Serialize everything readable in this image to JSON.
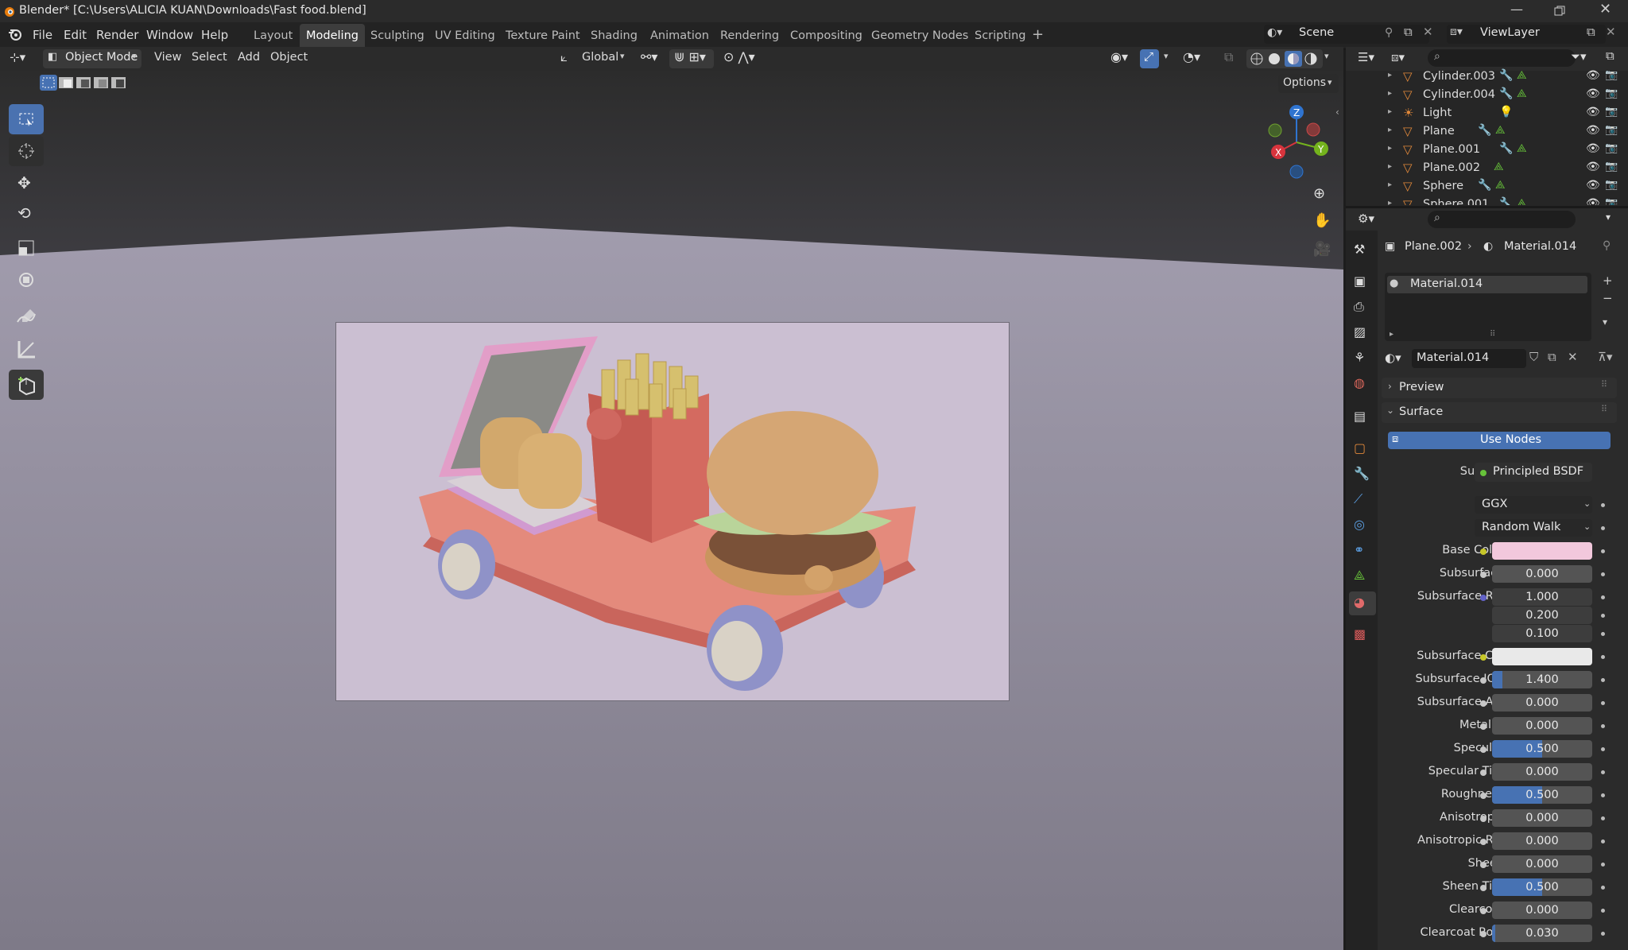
{
  "window": {
    "title": "Blender* [C:\\Users\\ALICIA KUAN\\Downloads\\Fast food.blend]"
  },
  "menus": [
    "File",
    "Edit",
    "Render",
    "Window",
    "Help"
  ],
  "workspaces": [
    "Layout",
    "Modeling",
    "Sculpting",
    "UV Editing",
    "Texture Paint",
    "Shading",
    "Animation",
    "Rendering",
    "Compositing",
    "Geometry Nodes",
    "Scripting"
  ],
  "active_workspace": "Modeling",
  "scene": {
    "label": "Scene"
  },
  "viewlayer": {
    "label": "ViewLayer"
  },
  "viewport_header": {
    "mode": "Object Mode",
    "view": "View",
    "select": "Select",
    "add": "Add",
    "object": "Object",
    "orientation": "Global",
    "options": "Options"
  },
  "gizmo": {
    "z": "Z",
    "y": "Y",
    "x": "X"
  },
  "outliner": {
    "items": [
      {
        "name": "Cylinder.003",
        "type": "mesh"
      },
      {
        "name": "Cylinder.004",
        "type": "mesh"
      },
      {
        "name": "Light",
        "type": "light"
      },
      {
        "name": "Plane",
        "type": "mesh"
      },
      {
        "name": "Plane.001",
        "type": "mesh"
      },
      {
        "name": "Plane.002",
        "type": "mesh"
      },
      {
        "name": "Sphere",
        "type": "mesh"
      },
      {
        "name": "Sphere.001",
        "type": "mesh"
      }
    ]
  },
  "properties": {
    "breadcrumb_object": "Plane.002",
    "breadcrumb_material": "Material.014",
    "slot": "Material.014",
    "material_name": "Material.014",
    "preview": "Preview",
    "surface": "Surface",
    "use_nodes": "Use Nodes",
    "surface_label": "Surface",
    "surface_shader": "Principled BSDF",
    "distribution": "GGX",
    "subsurface_method": "Random Walk",
    "rows": [
      {
        "label": "Base Color",
        "value": "",
        "kind": "color",
        "color": "#f2c8dc"
      },
      {
        "label": "Subsurface",
        "value": "0.000",
        "fill": 0
      },
      {
        "label": "Subsurface R...",
        "value": "1.000",
        "fill": 0
      },
      {
        "label": "",
        "value": "0.200",
        "fill": 0
      },
      {
        "label": "",
        "value": "0.100",
        "fill": 0
      },
      {
        "label": "Subsurface C...",
        "value": "",
        "kind": "color",
        "color": "#e9e9e9"
      },
      {
        "label": "Subsurface IOR",
        "value": "1.400",
        "fill": 0.1
      },
      {
        "label": "Subsurface A...",
        "value": "0.000",
        "fill": 0
      },
      {
        "label": "Metallic",
        "value": "0.000",
        "fill": 0
      },
      {
        "label": "Specular",
        "value": "0.500",
        "fill": 0.5
      },
      {
        "label": "Specular Tint",
        "value": "0.000",
        "fill": 0
      },
      {
        "label": "Roughness",
        "value": "0.500",
        "fill": 0.5
      },
      {
        "label": "Anisotropic",
        "value": "0.000",
        "fill": 0
      },
      {
        "label": "Anisotropic R...",
        "value": "0.000",
        "fill": 0
      },
      {
        "label": "Sheen",
        "value": "0.000",
        "fill": 0
      },
      {
        "label": "Sheen Tint",
        "value": "0.500",
        "fill": 0.5
      },
      {
        "label": "Clearcoat",
        "value": "0.000",
        "fill": 0
      },
      {
        "label": "Clearcoat Ro...",
        "value": "0.030",
        "fill": 0.03
      }
    ]
  },
  "colors": {
    "accent": "#4772b3",
    "mesh_orange": "#e0883a",
    "data_green": "#67c23a"
  }
}
